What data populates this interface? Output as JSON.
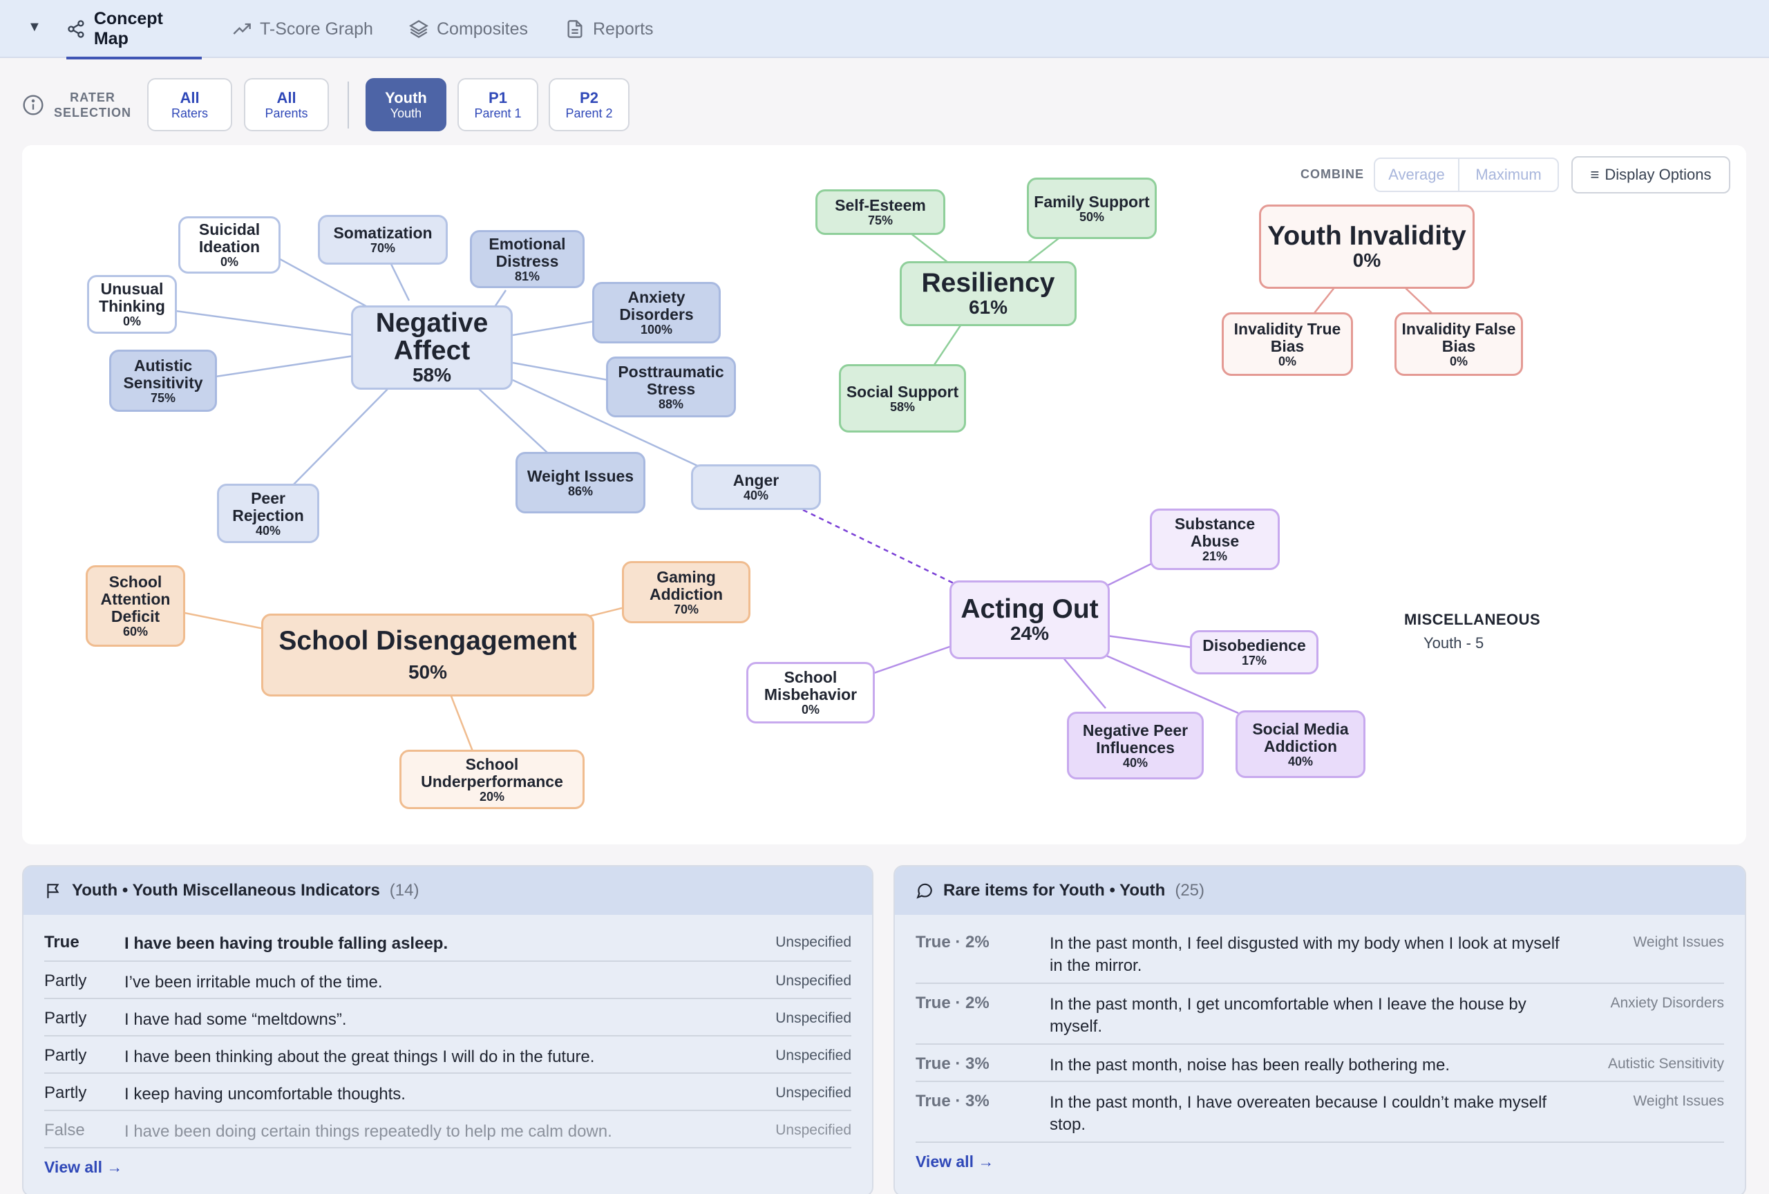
{
  "tabs": [
    {
      "label": "Concept Map",
      "icon": "share-nodes-icon",
      "active": true
    },
    {
      "label": "T-Score Graph",
      "icon": "trend-up-icon",
      "active": false
    },
    {
      "label": "Composites",
      "icon": "layers-icon",
      "active": false
    },
    {
      "label": "Reports",
      "icon": "document-icon",
      "active": false
    }
  ],
  "rater": {
    "label_line1": "RATER",
    "label_line2": "SELECTION",
    "buttons": [
      {
        "title": "All",
        "sub": "Raters",
        "active": false
      },
      {
        "title": "All",
        "sub": "Parents",
        "active": false
      },
      {
        "title": "Youth",
        "sub": "Youth",
        "active": true
      },
      {
        "title": "P1",
        "sub": "Parent 1",
        "active": false
      },
      {
        "title": "P2",
        "sub": "Parent 2",
        "active": false
      }
    ]
  },
  "combine": {
    "label": "COMBINE",
    "options": [
      "Average",
      "Maximum"
    ]
  },
  "display_options": "Display Options",
  "nodes": {
    "negative_affect": {
      "name": "Negative Affect",
      "pct": "58%"
    },
    "suicidal_ideation": {
      "name": "Suicidal Ideation",
      "pct": "0%"
    },
    "somatization": {
      "name": "Somatization",
      "pct": "70%"
    },
    "emotional_distress": {
      "name": "Emotional Distress",
      "pct": "81%"
    },
    "anxiety_disorders": {
      "name": "Anxiety Disorders",
      "pct": "100%"
    },
    "posttraumatic_stress": {
      "name": "Posttraumatic Stress",
      "pct": "88%"
    },
    "unusual_thinking": {
      "name": "Unusual Thinking",
      "pct": "0%"
    },
    "autistic_sensitivity": {
      "name": "Autistic Sensitivity",
      "pct": "75%"
    },
    "peer_rejection": {
      "name": "Peer Rejection",
      "pct": "40%"
    },
    "weight_issues": {
      "name": "Weight Issues",
      "pct": "86%"
    },
    "anger": {
      "name": "Anger",
      "pct": "40%"
    },
    "resiliency": {
      "name": "Resiliency",
      "pct": "61%"
    },
    "self_esteem": {
      "name": "Self-Esteem",
      "pct": "75%"
    },
    "family_support": {
      "name": "Family Support",
      "pct": "50%"
    },
    "social_support": {
      "name": "Social Support",
      "pct": "58%"
    },
    "youth_invalidity": {
      "name": "Youth Invalidity",
      "pct": "0%"
    },
    "invalidity_true_bias": {
      "name": "Invalidity True Bias",
      "pct": "0%"
    },
    "invalidity_false_bias": {
      "name": "Invalidity False Bias",
      "pct": "0%"
    },
    "school_disengagement": {
      "name": "School Disengagement",
      "pct": "50%"
    },
    "school_attention_deficit": {
      "name": "School Attention Deficit",
      "pct": "60%"
    },
    "gaming_addiction": {
      "name": "Gaming Addiction",
      "pct": "70%"
    },
    "school_underperformance": {
      "name": "School Underperformance",
      "pct": "20%"
    },
    "acting_out": {
      "name": "Acting Out",
      "pct": "24%"
    },
    "substance_abuse": {
      "name": "Substance Abuse",
      "pct": "21%"
    },
    "disobedience": {
      "name": "Disobedience",
      "pct": "17%"
    },
    "school_misbehavior": {
      "name": "School Misbehavior",
      "pct": "0%"
    },
    "negative_peer_influences": {
      "name": "Negative Peer Influences",
      "pct": "40%"
    },
    "social_media_addiction": {
      "name": "Social Media Addiction",
      "pct": "40%"
    }
  },
  "misc": {
    "title": "MISCELLANEOUS",
    "sub": "Youth - 5"
  },
  "misc_panel": {
    "title": "Youth • Youth Miscellaneous Indicators",
    "count": "(14)",
    "rows": [
      {
        "answer": "True",
        "text": "I have been having trouble falling asleep.",
        "tag": "Unspecified"
      },
      {
        "answer": "Partly",
        "text": "I’ve been irritable much of the time.",
        "tag": "Unspecified"
      },
      {
        "answer": "Partly",
        "text": "I have had some “meltdowns”.",
        "tag": "Unspecified"
      },
      {
        "answer": "Partly",
        "text": "I have been thinking about the great things I will do in the future.",
        "tag": "Unspecified"
      },
      {
        "answer": "Partly",
        "text": "I keep having uncomfortable thoughts.",
        "tag": "Unspecified"
      },
      {
        "answer": "False",
        "text": "I have been doing certain things repeatedly to help me calm down.",
        "tag": "Unspecified"
      }
    ],
    "view_all": "View all →"
  },
  "rare_panel": {
    "title": "Rare items for Youth • Youth",
    "count": "(25)",
    "rows": [
      {
        "answer": "True · 2%",
        "text1": "In the past month, I feel disgusted with my body when I look at myself",
        "text2": "in the mirror.",
        "tag": "Weight Issues"
      },
      {
        "answer": "True · 2%",
        "text1": "In the past month, I get uncomfortable when I leave the house by",
        "text2": "myself.",
        "tag": "Anxiety Disorders"
      },
      {
        "answer": "True · 3%",
        "text1": "In the past month, noise has been really bothering me.",
        "text2": "",
        "tag": "Autistic Sensitivity"
      },
      {
        "answer": "True · 3%",
        "text1": "In the past month, I have overeaten because I couldn’t make myself",
        "text2": "stop.",
        "tag": "Weight Issues"
      }
    ],
    "view_all": "View all →"
  }
}
